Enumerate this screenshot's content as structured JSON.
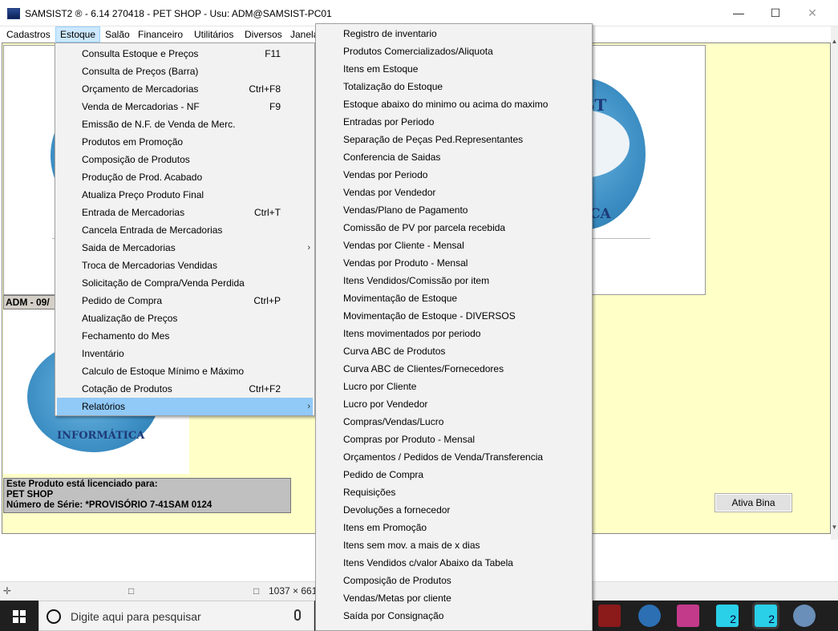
{
  "window": {
    "title": "SAMSIST2 ® - 6.14  270418 - PET SHOP - Usu: ADM@SAMSIST-PC01",
    "icon_label": "SAMSIST",
    "controls": [
      "minimize-icon",
      "maximize-icon",
      "close-icon"
    ]
  },
  "menubar": [
    "Cadastros",
    "Estoque",
    "Salão",
    "Financeiro",
    "Utilitários",
    "Diversos",
    "Janela"
  ],
  "estoque_menu": [
    {
      "label": "Consulta Estoque e Preços",
      "shortcut": "F11"
    },
    {
      "label": "Consulta de Preços (Barra)",
      "shortcut": ""
    },
    {
      "label": "Orçamento de Mercadorias",
      "shortcut": "Ctrl+F8"
    },
    {
      "label": "Venda de Mercadorias - NF",
      "shortcut": "F9"
    },
    {
      "label": "Emissão de N.F. de Venda de Merc.",
      "shortcut": ""
    },
    {
      "label": "Produtos em Promoção",
      "shortcut": ""
    },
    {
      "label": "Composição de Produtos",
      "shortcut": ""
    },
    {
      "label": "Produção de Prod. Acabado",
      "shortcut": ""
    },
    {
      "label": "Atualiza Preço Produto Final",
      "shortcut": ""
    },
    {
      "label": "Entrada de Mercadorias",
      "shortcut": "Ctrl+T"
    },
    {
      "label": "Cancela Entrada de Mercadorias",
      "shortcut": ""
    },
    {
      "label": "Saida de Mercadorias",
      "shortcut": "",
      "submenu": true
    },
    {
      "label": "Troca de Mercadorias Vendidas",
      "shortcut": ""
    },
    {
      "label": "Solicitação de Compra/Venda Perdida",
      "shortcut": ""
    },
    {
      "label": "Pedido de Compra",
      "shortcut": "Ctrl+P"
    },
    {
      "label": "Atualização de Preços",
      "shortcut": ""
    },
    {
      "label": "Fechamento do Mes",
      "shortcut": ""
    },
    {
      "label": "Inventário",
      "shortcut": ""
    },
    {
      "label": "Calculo de Estoque Mínimo e Máximo",
      "shortcut": ""
    },
    {
      "label": "Cotação de Produtos",
      "shortcut": "Ctrl+F2"
    },
    {
      "label": "Relatórios",
      "shortcut": "",
      "submenu": true,
      "highlighted": true
    }
  ],
  "relatorios_menu": [
    "Registro de inventario",
    "Produtos Comercializados/Aliquota",
    "Itens em Estoque",
    "Totalização do Estoque",
    "Estoque abaixo do minimo ou acima do maximo",
    "Entradas por Periodo",
    "Separação de Peças Ped.Representantes",
    "Conferencia de Saidas",
    "Vendas por Periodo",
    "Vendas por Vendedor",
    "Vendas/Plano de Pagamento",
    "Comissão de PV por parcela recebida",
    "Vendas por Cliente - Mensal",
    "Vendas por Produto - Mensal",
    "Itens Vendidos/Comissão por item",
    "Movimentação de Estoque",
    "Movimentação de Estoque - DIVERSOS",
    "Itens movimentados por periodo",
    "Curva ABC de Produtos",
    "Curva ABC de Clientes/Fornecedores",
    "Lucro por Cliente",
    "Lucro por Vendedor",
    "Compras/Vendas/Lucro",
    "Compras por Produto - Mensal",
    "Orçamentos / Pedidos de Venda/Transferencia",
    "Pedido de Compra",
    "Requisições",
    "Devoluções a fornecedor",
    "Itens em Promoção",
    "Itens sem mov. a mais de x dias",
    "Itens Vendidos c/valor Abaixo da Tabela",
    "Composição de Produtos",
    "Vendas/Metas por cliente",
    "Saída por Consignação"
  ],
  "user_bar": "ADM - 09/",
  "logo": {
    "top_text_a": "ST",
    "top_text_b": "ICA",
    "bottom_text": "INFORMÁTICA"
  },
  "license": {
    "line1": "Este Produto está licenciado para:",
    "line2": "PET SHOP",
    "line3": "Número de Série: *PROVISÓRIO 7-41SAM    0124"
  },
  "ativa_button": "Ativa Bina",
  "statusbar": {
    "dims": "1037 × 661"
  },
  "taskbar": {
    "search_placeholder": "Digite aqui para pesquisar",
    "app_badge": "2"
  },
  "colors": {
    "client_bg": "#ffffc8",
    "menu_highlight": "#91c9f7",
    "menubar_active": "#cce8ff",
    "globe": "#3d8fc4"
  }
}
